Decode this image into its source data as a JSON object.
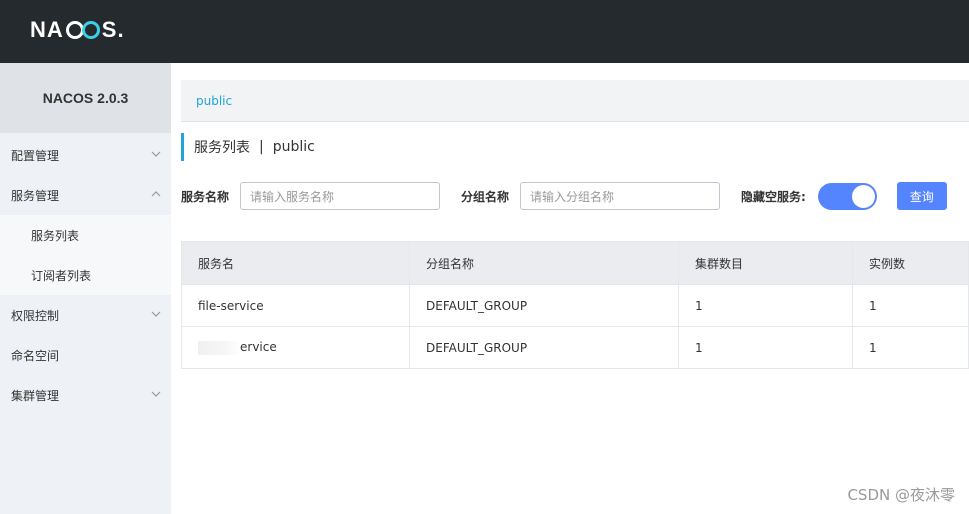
{
  "header": {
    "logo_left": "NA",
    "logo_right": "S.",
    "logo_full": "NACOS."
  },
  "sidebar": {
    "version": "NACOS 2.0.3",
    "items": [
      {
        "label": "配置管理",
        "chevron": "down"
      },
      {
        "label": "服务管理",
        "chevron": "up"
      },
      {
        "label": "服务列表"
      },
      {
        "label": "订阅者列表"
      },
      {
        "label": "权限控制",
        "chevron": "down"
      },
      {
        "label": "命名空间"
      },
      {
        "label": "集群管理",
        "chevron": "down"
      }
    ]
  },
  "main": {
    "namespace_tab": "public",
    "title": "服务列表",
    "separator": "|",
    "namespace": "public",
    "filters": {
      "service_name_label": "服务名称",
      "service_name_placeholder": "请输入服务名称",
      "group_name_label": "分组名称",
      "group_name_placeholder": "请输入分组名称",
      "hide_empty_label": "隐藏空服务:",
      "hide_empty_on": true,
      "query_button": "查询"
    },
    "table": {
      "headers": [
        "服务名",
        "分组名称",
        "集群数目",
        "实例数"
      ],
      "rows": [
        [
          "file-service",
          "DEFAULT_GROUP",
          "1",
          "1"
        ],
        [
          "ervice",
          "DEFAULT_GROUP",
          "1",
          "1"
        ]
      ]
    }
  },
  "watermark": "CSDN @夜沐零",
  "colors": {
    "topbar": "#252a2f",
    "accent": "#1fa3d9",
    "primary": "#5584ff"
  }
}
